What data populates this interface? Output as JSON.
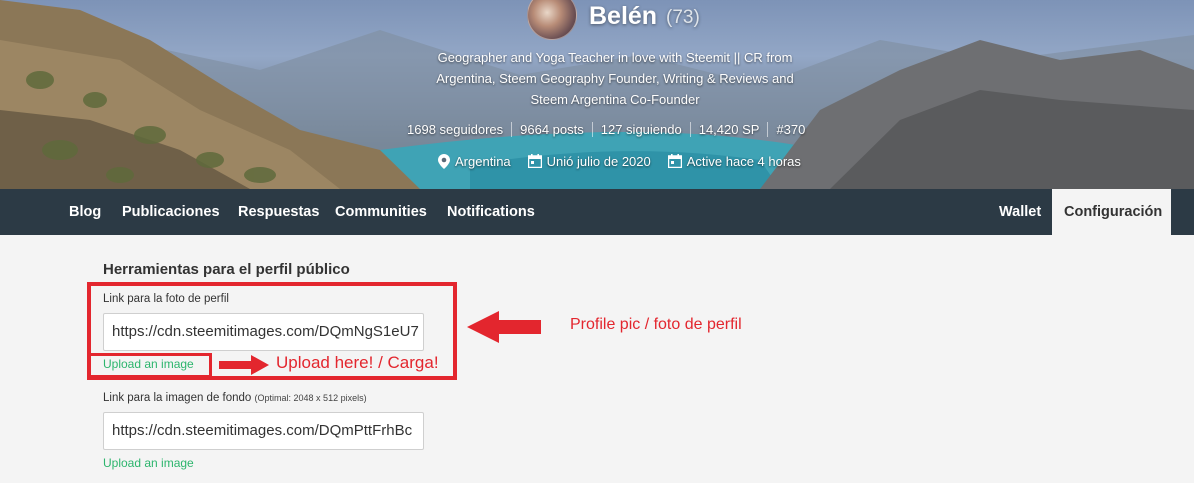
{
  "profile": {
    "name": "Belén",
    "reputation": "(73)",
    "bio_lines": [
      "Geographer and Yoga Teacher in love with Steemit || CR from",
      "Argentina, Steem Geography Founder, Writing & Reviews and",
      "Steem Argentina Co-Founder"
    ],
    "stats": {
      "followers": "1698 seguidores",
      "posts": "9664 posts",
      "following": "127 siguiendo",
      "sp": "14,420 SP",
      "rank": "#370"
    },
    "location": "Argentina",
    "joined": "Unió julio de 2020",
    "active": "Active hace 4 horas",
    "icons": {
      "location": "location-pin-icon",
      "joined": "calendar-icon",
      "active": "calendar-icon"
    }
  },
  "nav": {
    "tabs": [
      "Blog",
      "Publicaciones",
      "Respuestas",
      "Communities",
      "Notifications"
    ],
    "wallet": "Wallet",
    "settings": "Configuración"
  },
  "settings": {
    "section_title": "Herramientas para el perfil público",
    "profile_pic": {
      "label": "Link para la foto de perfil",
      "value": "https://cdn.steemitimages.com/DQmNgS1eU7",
      "upload": "Upload an image"
    },
    "cover_image": {
      "label": "Link para la imagen de fondo",
      "hint": "(Optimal: 2048 x 512 pixels)",
      "value": "https://cdn.steemitimages.com/DQmPttFrhBc",
      "upload": "Upload an image"
    }
  },
  "annotations": {
    "profile_pic_note": "Profile pic / foto de perfil",
    "upload_note": "Upload here! / Carga!",
    "color": "#e3262e"
  },
  "colors": {
    "nav_bg": "#2c3a45",
    "page_bg": "#f4f4f4",
    "link_blue": "#4ba2f2",
    "link_green": "#2db56d"
  }
}
